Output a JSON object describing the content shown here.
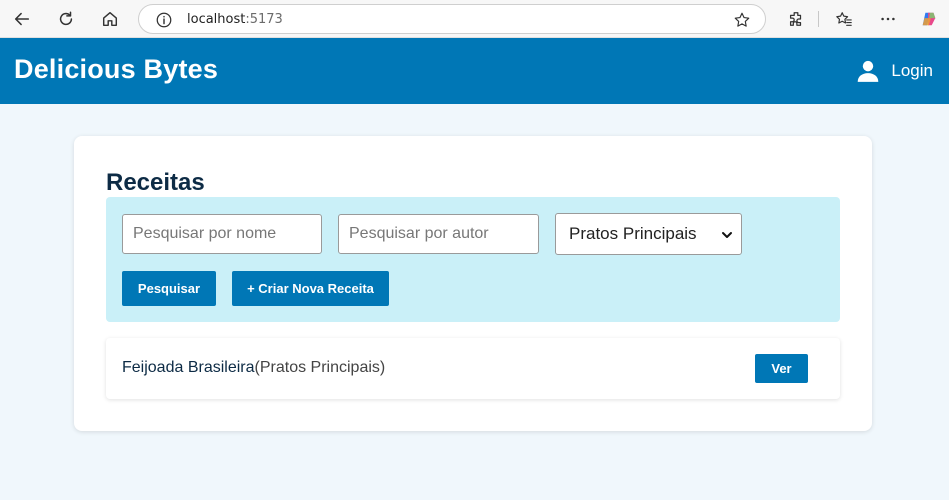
{
  "browser": {
    "url_host": "localhost",
    "url_port": ":5173"
  },
  "header": {
    "brand": "Delicious Bytes",
    "login_label": "Login"
  },
  "main": {
    "title": "Receitas",
    "search_name_placeholder": "Pesquisar por nome",
    "search_author_placeholder": "Pesquisar por autor",
    "category_selected": "Pratos Principais",
    "search_button": "Pesquisar",
    "create_button": "+ Criar Nova Receita",
    "results": [
      {
        "name": "Feijoada Brasileira",
        "category": "(Pratos Principais)",
        "view_label": "Ver"
      }
    ]
  },
  "colors": {
    "primary": "#0077b6",
    "filter_bg": "#caf0f8",
    "page_bg": "#f0f7fc",
    "title_text": "#0d2b45"
  }
}
